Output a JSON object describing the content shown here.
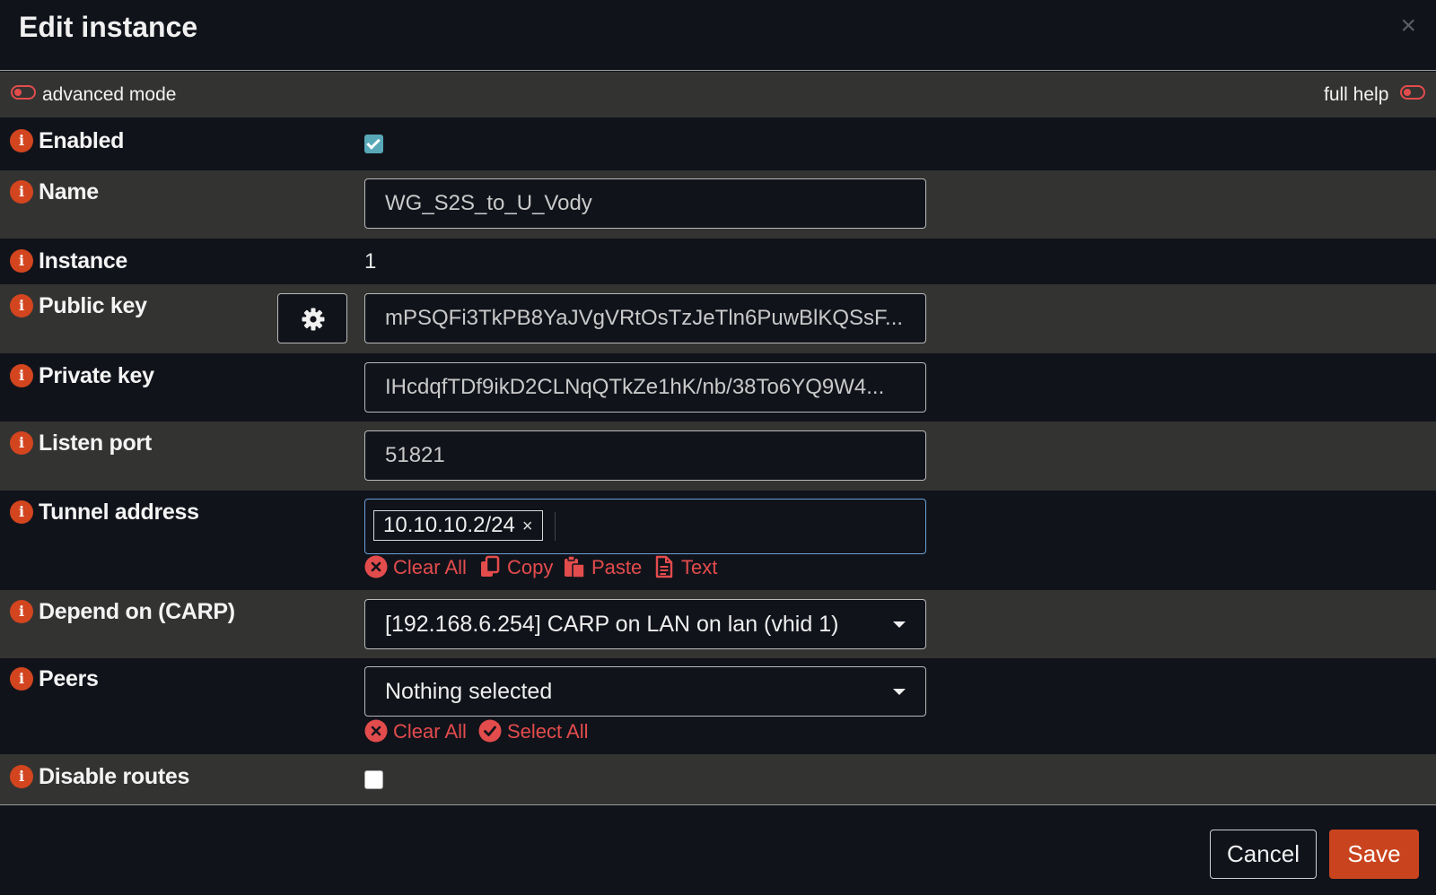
{
  "dialog": {
    "title": "Edit instance",
    "close_label": "×"
  },
  "mode_bar": {
    "advanced_mode_label": "advanced mode",
    "full_help_label": "full help"
  },
  "fields": {
    "enabled": {
      "label": "Enabled",
      "checked": true
    },
    "name": {
      "label": "Name",
      "value": "WG_S2S_to_U_Vody"
    },
    "instance": {
      "label": "Instance",
      "value": "1"
    },
    "public_key": {
      "label": "Public key",
      "value": "mPSQFi3TkPB8YaJVgVRtOsTzJeTln6PuwBlKQSsF..."
    },
    "private_key": {
      "label": "Private key",
      "value": "IHcdqfTDf9ikD2CLNqQTkZe1hK/nb/38To6YQ9W4..."
    },
    "listen_port": {
      "label": "Listen port",
      "value": "51821"
    },
    "tunnel_address": {
      "label": "Tunnel address",
      "tags": [
        "10.10.10.2/24"
      ],
      "tag_remove": "×",
      "actions": {
        "clear_all": "Clear All",
        "copy": "Copy",
        "paste": "Paste",
        "text": "Text"
      }
    },
    "depend_on_carp": {
      "label": "Depend on (CARP)",
      "selected": "[192.168.6.254] CARP on LAN on lan (vhid 1)"
    },
    "peers": {
      "label": "Peers",
      "selected": "Nothing selected",
      "actions": {
        "clear_all": "Clear All",
        "select_all": "Select All"
      }
    },
    "disable_routes": {
      "label": "Disable routes",
      "checked": false
    }
  },
  "footer": {
    "cancel_label": "Cancel",
    "save_label": "Save"
  },
  "colors": {
    "accent_red": "#e34c4c",
    "info_icon": "#d2451f",
    "save_button": "#c9441e",
    "checkbox_checked": "#58a8b8",
    "background": "#11131b",
    "row_alt": "#333332"
  },
  "icons": {
    "info": "info-icon",
    "gear": "gear-icon",
    "toggle": "toggle-off-icon",
    "clear": "x-circle-icon",
    "copy": "copy-icon",
    "paste": "paste-icon",
    "text": "file-text-icon",
    "select_all": "check-circle-icon",
    "caret": "caret-down-icon"
  }
}
